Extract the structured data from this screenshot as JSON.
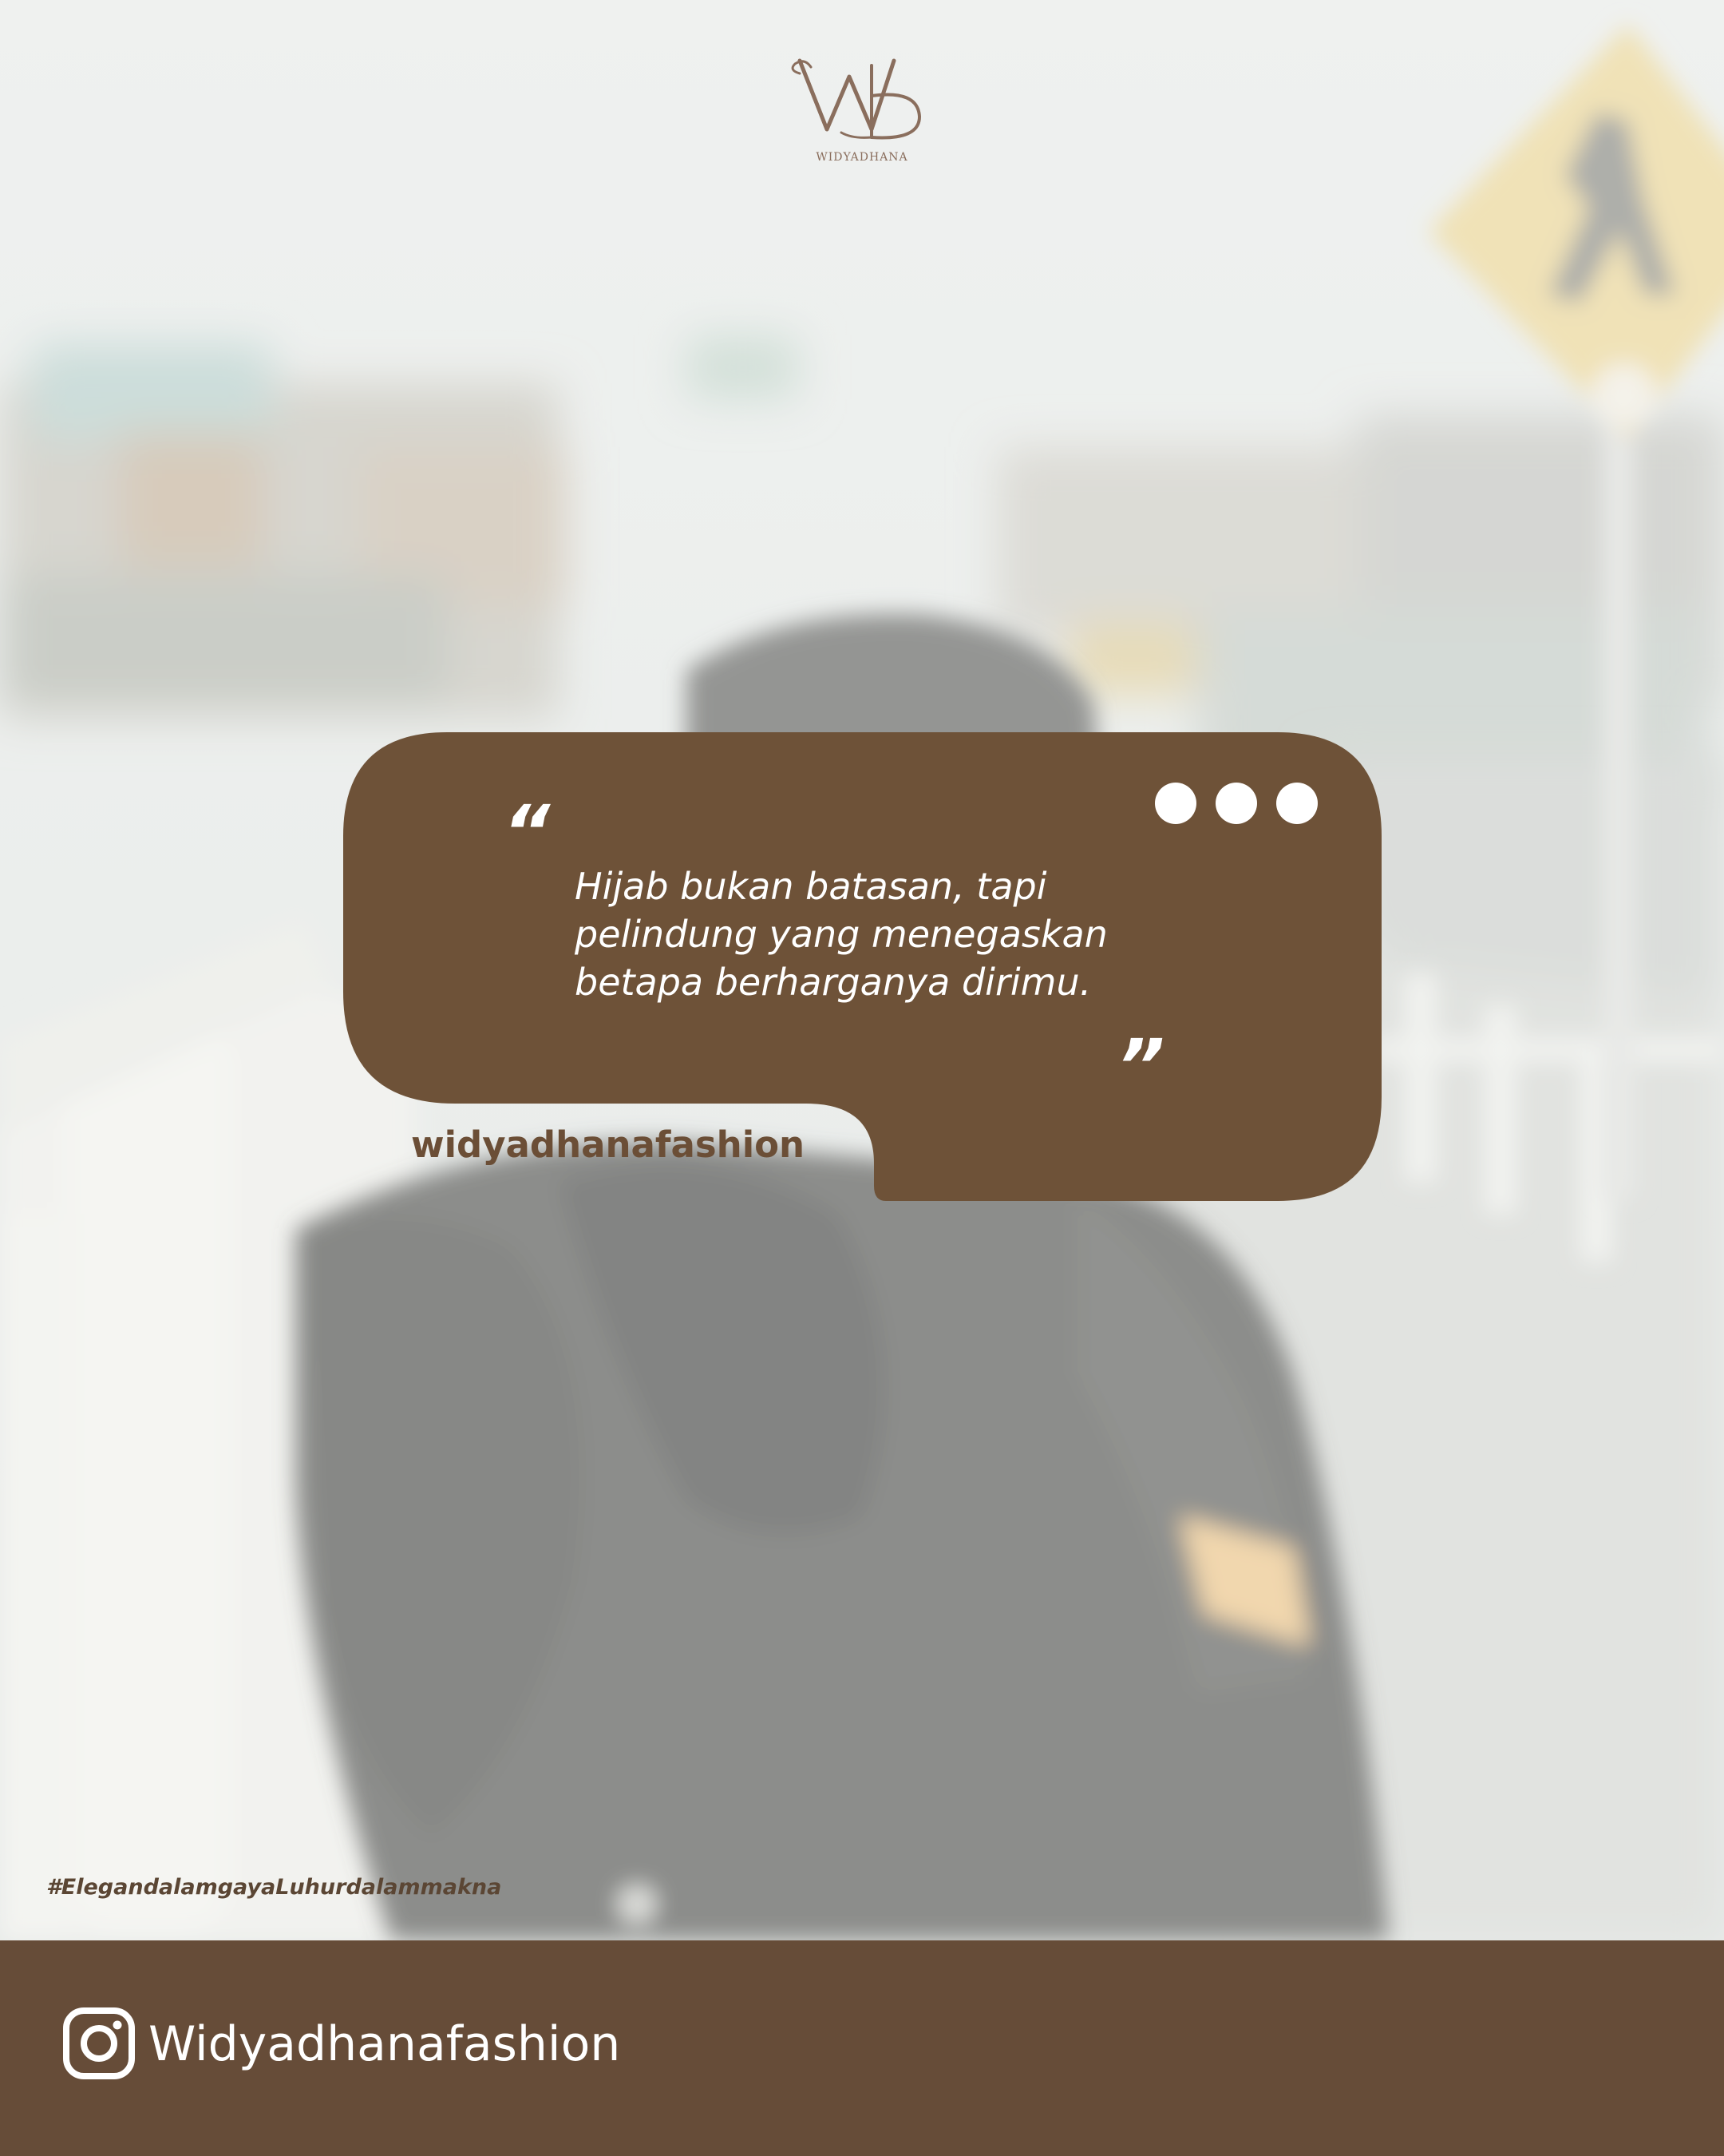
{
  "brand": {
    "logo_text": "WIDYADHANA",
    "logo_color": "#8a6e5d"
  },
  "quote": {
    "open_mark": "“",
    "close_mark": "”",
    "text": "Hijab bukan batasan, tapi pelindung yang menegaskan betapa berharganya dirimu.",
    "author_handle": "widyadhanafashion",
    "bubble_color": "#6e5238",
    "dots_icon": "more-dots-icon"
  },
  "hashtag": "#ElegandalamgayaLuhurdalammakna",
  "footer": {
    "icon": "instagram-icon",
    "handle": "Widyadhanafashion",
    "background_color": "#664c38"
  }
}
